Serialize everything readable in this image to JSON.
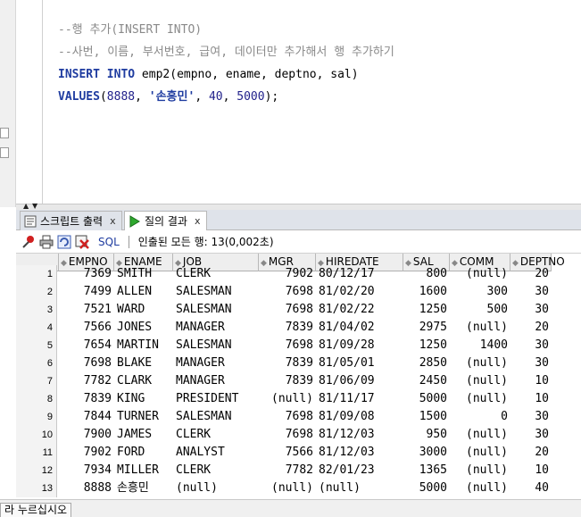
{
  "editor": {
    "lines": [
      {
        "segments": [
          {
            "t": "--행 추가(INSERT INTO)",
            "c": "cmt"
          }
        ]
      },
      {
        "segments": [
          {
            "t": "--사번, 이름, 부서번호, 급여, 데이터만 추가해서 행 추가하기",
            "c": "cmt"
          }
        ]
      },
      {
        "segments": [
          {
            "t": "INSERT",
            "c": "kw"
          },
          {
            "t": " ",
            "c": "plain"
          },
          {
            "t": "INTO",
            "c": "kw"
          },
          {
            "t": " emp2(empno, ename, deptno, sal)",
            "c": "plain"
          }
        ]
      },
      {
        "segments": [
          {
            "t": "VALUES",
            "c": "kw"
          },
          {
            "t": "(",
            "c": "plain"
          },
          {
            "t": "8888",
            "c": "num"
          },
          {
            "t": ", ",
            "c": "plain"
          },
          {
            "t": "'손흥민'",
            "c": "str"
          },
          {
            "t": ", ",
            "c": "plain"
          },
          {
            "t": "40",
            "c": "num"
          },
          {
            "t": ", ",
            "c": "plain"
          },
          {
            "t": "5000",
            "c": "num"
          },
          {
            "t": ");",
            "c": "plain"
          }
        ]
      }
    ]
  },
  "tabs": [
    {
      "label": "스크립트 출력",
      "close": "x",
      "icon": "script-output-icon"
    },
    {
      "label": "질의 결과",
      "close": "x",
      "icon": "run-triangle-icon"
    }
  ],
  "toolbar": {
    "sql_label": "SQL",
    "fetch_status": "인출된 모든 행: 13(0,002초)"
  },
  "grid": {
    "columns": [
      "EMPNO",
      "ENAME",
      "JOB",
      "MGR",
      "HIREDATE",
      "SAL",
      "COMM",
      "DEPTNO"
    ],
    "rows": [
      {
        "n": "1",
        "cells": [
          "7369",
          "SMITH",
          "CLERK",
          "7902",
          "80/12/17",
          "800",
          "(null)",
          "20"
        ]
      },
      {
        "n": "2",
        "cells": [
          "7499",
          "ALLEN",
          "SALESMAN",
          "7698",
          "81/02/20",
          "1600",
          "300",
          "30"
        ]
      },
      {
        "n": "3",
        "cells": [
          "7521",
          "WARD",
          "SALESMAN",
          "7698",
          "81/02/22",
          "1250",
          "500",
          "30"
        ]
      },
      {
        "n": "4",
        "cells": [
          "7566",
          "JONES",
          "MANAGER",
          "7839",
          "81/04/02",
          "2975",
          "(null)",
          "20"
        ]
      },
      {
        "n": "5",
        "cells": [
          "7654",
          "MARTIN",
          "SALESMAN",
          "7698",
          "81/09/28",
          "1250",
          "1400",
          "30"
        ]
      },
      {
        "n": "6",
        "cells": [
          "7698",
          "BLAKE",
          "MANAGER",
          "7839",
          "81/05/01",
          "2850",
          "(null)",
          "30"
        ]
      },
      {
        "n": "7",
        "cells": [
          "7782",
          "CLARK",
          "MANAGER",
          "7839",
          "81/06/09",
          "2450",
          "(null)",
          "10"
        ]
      },
      {
        "n": "8",
        "cells": [
          "7839",
          "KING",
          "PRESIDENT",
          "(null)",
          "81/11/17",
          "5000",
          "(null)",
          "10"
        ]
      },
      {
        "n": "9",
        "cells": [
          "7844",
          "TURNER",
          "SALESMAN",
          "7698",
          "81/09/08",
          "1500",
          "0",
          "30"
        ]
      },
      {
        "n": "10",
        "cells": [
          "7900",
          "JAMES",
          "CLERK",
          "7698",
          "81/12/03",
          "950",
          "(null)",
          "30"
        ]
      },
      {
        "n": "11",
        "cells": [
          "7902",
          "FORD",
          "ANALYST",
          "7566",
          "81/12/03",
          "3000",
          "(null)",
          "20"
        ]
      },
      {
        "n": "12",
        "cells": [
          "7934",
          "MILLER",
          "CLERK",
          "7782",
          "82/01/23",
          "1365",
          "(null)",
          "10"
        ]
      },
      {
        "n": "13",
        "cells": [
          "8888",
          "손흥민",
          "(null)",
          "(null)",
          "(null)",
          "5000",
          "(null)",
          "40"
        ]
      }
    ]
  },
  "bottom": {
    "tab_label": "라 누르십시오"
  },
  "colors": {
    "keyword": "#1f3ca0",
    "comment": "#8a8a8a",
    "header_bg": "#eeeeee",
    "tab_bg": "#dfe3ea"
  }
}
